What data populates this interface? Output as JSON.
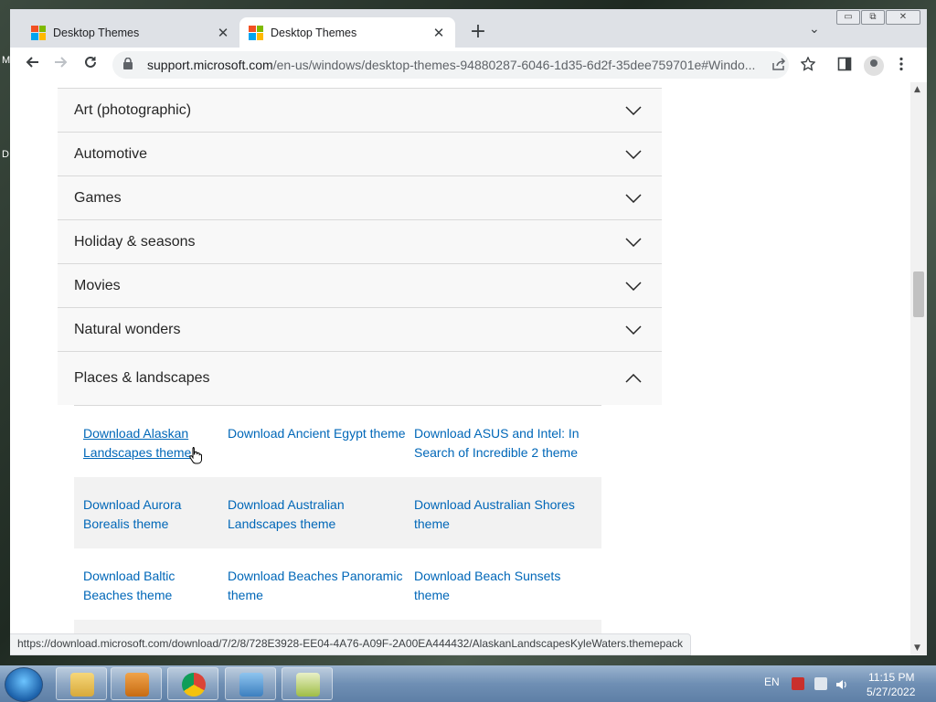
{
  "desktop": {
    "label_m": "M",
    "label_d": "D"
  },
  "window": {
    "controls": {
      "minimize": "▭",
      "restore": "⧉",
      "close": "✕"
    }
  },
  "tabs": [
    {
      "title": "Desktop Themes",
      "close": "✕"
    },
    {
      "title": "Desktop Themes",
      "close": "✕"
    }
  ],
  "new_tab": "+",
  "tab_search": "⌄",
  "url": {
    "host": "support.microsoft.com",
    "path": "/en-us/windows/desktop-themes-94880287-6046-1d35-6d2f-35dee759701e#Windo..."
  },
  "accordion": [
    {
      "label": "Art (photographic)"
    },
    {
      "label": "Automotive"
    },
    {
      "label": "Games"
    },
    {
      "label": "Holiday & seasons"
    },
    {
      "label": "Movies"
    },
    {
      "label": "Natural wonders"
    }
  ],
  "open_section": {
    "label": "Places & landscapes",
    "rows": [
      [
        "Download Alaskan Landscapes theme",
        "Download Ancient Egypt theme",
        "Download ASUS and Intel: In Search of Incredible 2 theme"
      ],
      [
        "Download Aurora Borealis theme",
        "Download Australian Landscapes theme",
        "Download Australian Shores theme"
      ],
      [
        "Download Baltic Beaches theme",
        "Download Beaches Panoramic theme",
        "Download Beach Sunsets theme"
      ]
    ]
  },
  "status_url": "https://download.microsoft.com/download/7/2/8/728E3928-EE04-4A76-A09F-2A00EA444432/AlaskanLandscapesKyleWaters.themepack",
  "taskbar": {
    "language": "EN",
    "time": "11:15 PM",
    "date": "5/27/2022"
  },
  "colors": {
    "link": "#0067b8",
    "ms_red": "#f25022",
    "ms_green": "#7fba00",
    "ms_blue": "#00a4ef",
    "ms_yellow": "#ffb900"
  }
}
